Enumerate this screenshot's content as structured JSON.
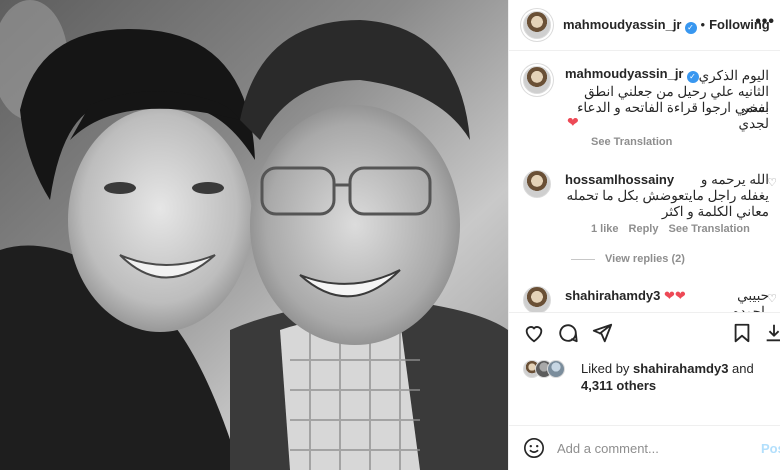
{
  "post": {
    "image_description_icon": "photo-black-and-white-portrait"
  },
  "header": {
    "username": "mahmoudyassin_jr",
    "separator": "•",
    "follow_label": "Following",
    "more_icon": "more-options-icon",
    "more_label": "•••"
  },
  "caption": {
    "username": "mahmoudyassin_jr",
    "lines": [
      "اليوم الذكري",
      "الثانيه علي رحيل من جعلني انطق اسمي",
      "بفخر . ارجوا قراءة الفاتحه و الدعاء لجدي"
    ],
    "heart": "❤",
    "see_translation": "See Translation"
  },
  "comments": [
    {
      "username": "hossamlhossainy",
      "lines": [
        "الله يرحمه و",
        "يغفله راجل مايتعوضش بكل ما تحمله",
        "معاني الكلمة و اكثر"
      ],
      "likes": "1 like",
      "reply": "Reply",
      "see_translation": "See Translation",
      "view_replies": "View replies (2)"
    },
    {
      "username": "shahirahamdy3",
      "hearts": "❤❤",
      "text": "حبيبي ياحوده"
    }
  ],
  "actions": {
    "like_icon": "heart-outline-icon",
    "comment_icon": "comment-icon",
    "share_icon": "paper-plane-icon",
    "save_icon": "bookmark-icon",
    "download_icon": "download-icon"
  },
  "likes": {
    "prefix": "Liked by",
    "user": "shahirahamdy3",
    "and": "and",
    "others": "4,311 others"
  },
  "add_comment": {
    "emoji_icon": "smiley-icon",
    "placeholder": "Add a comment...",
    "post_label": "Post"
  },
  "colors": {
    "verified": "#3897f0",
    "heart_red": "#ed4956",
    "muted": "#8e8e8e",
    "post_disabled": "#b2dffc"
  }
}
